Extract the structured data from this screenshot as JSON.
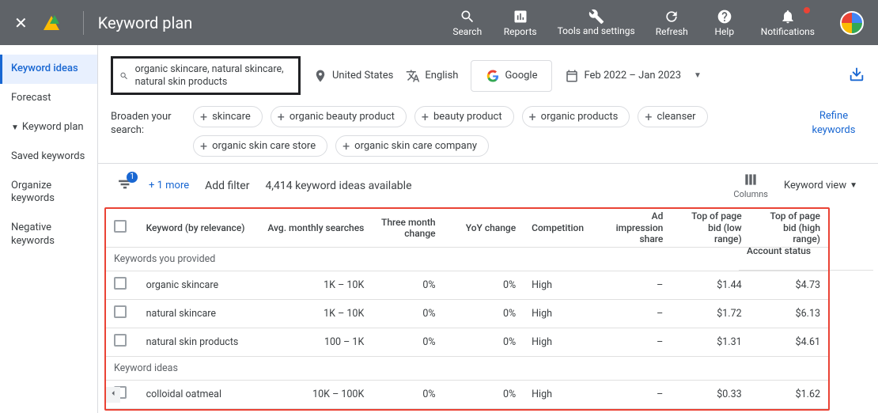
{
  "header": {
    "title": "Keyword plan",
    "nav": {
      "search": "Search",
      "reports": "Reports",
      "tools": "Tools and settings",
      "refresh": "Refresh",
      "help": "Help",
      "notifications": "Notifications"
    }
  },
  "sidebar": {
    "keyword_ideas": "Keyword ideas",
    "forecast": "Forecast",
    "keyword_plan": "Keyword plan",
    "saved_keywords": "Saved keywords",
    "organize_keywords": "Organize keywords",
    "negative_keywords": "Negative keywords"
  },
  "filters": {
    "search_terms": "organic skincare, natural skincare, natural skin products",
    "location": "United States",
    "language": "English",
    "network": "Google",
    "date_range": "Feb 2022 – Jan 2023"
  },
  "broaden": {
    "label": "Broaden your search:",
    "chips": [
      "skincare",
      "organic beauty product",
      "beauty product",
      "organic products",
      "cleanser",
      "organic skin care store",
      "organic skin care company"
    ],
    "refine": "Refine keywords"
  },
  "filterline": {
    "badge": "1",
    "more": "+ 1 more",
    "add_filter": "Add filter",
    "count_text": "4,414 keyword ideas available",
    "columns": "Columns",
    "keyword_view": "Keyword view"
  },
  "table": {
    "headers": {
      "keyword": "Keyword (by relevance)",
      "avg": "Avg. monthly searches",
      "three_month": "Three month change",
      "yoy": "YoY change",
      "competition": "Competition",
      "ad_impr": "Ad impression share",
      "bid_low": "Top of page bid (low range)",
      "bid_high": "Top of page bid (high range)",
      "account_status": "Account status"
    },
    "sections": {
      "provided": "Keywords you provided",
      "ideas": "Keyword ideas"
    },
    "rows_provided": [
      {
        "kw": "organic skincare",
        "avg": "1K – 10K",
        "tm": "0%",
        "yoy": "0%",
        "comp": "High",
        "imp": "–",
        "low": "$1.44",
        "high": "$4.73"
      },
      {
        "kw": "natural skincare",
        "avg": "1K – 10K",
        "tm": "0%",
        "yoy": "0%",
        "comp": "High",
        "imp": "–",
        "low": "$1.72",
        "high": "$6.13"
      },
      {
        "kw": "natural skin products",
        "avg": "100 – 1K",
        "tm": "0%",
        "yoy": "0%",
        "comp": "High",
        "imp": "–",
        "low": "$1.31",
        "high": "$4.61"
      }
    ],
    "rows_ideas": [
      {
        "kw": "colloidal oatmeal",
        "avg": "10K – 100K",
        "tm": "0%",
        "yoy": "0%",
        "comp": "High",
        "imp": "–",
        "low": "$0.33",
        "high": "$1.62"
      }
    ]
  }
}
